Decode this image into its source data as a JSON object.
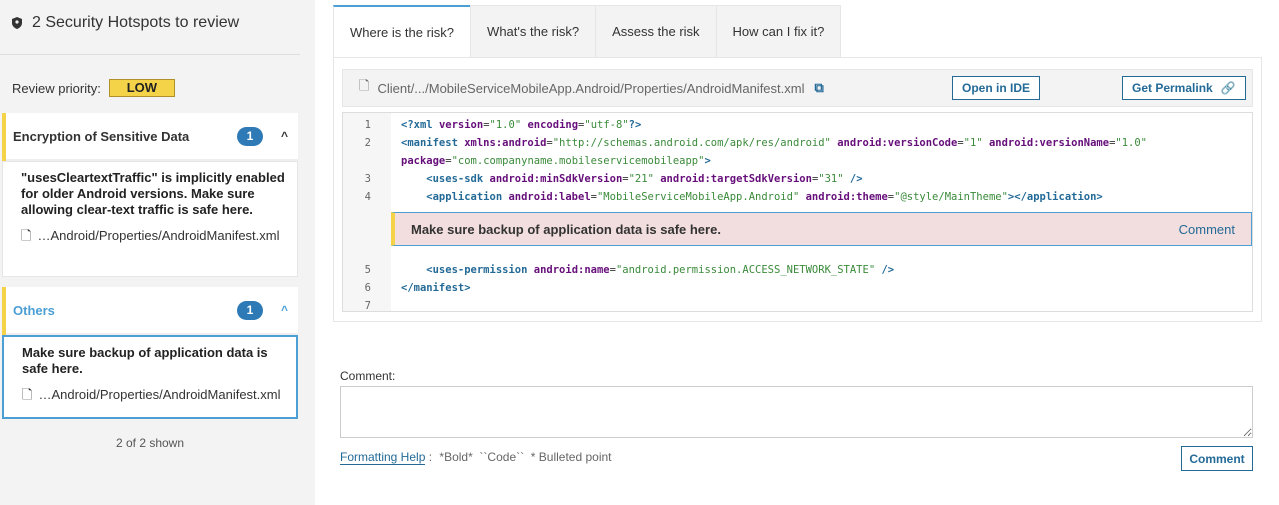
{
  "sidebar": {
    "title": "2 Security Hotspots to review",
    "review_priority_label": "Review priority:",
    "review_priority": "LOW",
    "categories": [
      {
        "name": "Encryption of Sensitive Data",
        "count": "1",
        "items": [
          {
            "message": "\"usesCleartextTraffic\" is implicitly enabled for older Android versions. Make sure allowing clear-text traffic is safe here.",
            "file": "…Android/Properties/AndroidManifest.xml"
          }
        ]
      },
      {
        "name": "Others",
        "count": "1",
        "items": [
          {
            "message": "Make sure backup of application data is safe here.",
            "file": "…Android/Properties/AndroidManifest.xml"
          }
        ]
      }
    ],
    "shown": "2 of 2 shown"
  },
  "tabs": [
    "Where is the risk?",
    "What's the risk?",
    "Assess the risk",
    "How can I fix it?"
  ],
  "code_viewer": {
    "path": "Client/.../MobileServiceMobileApp.Android/Properties/AndroidManifest.xml",
    "open_in_ide": "Open in IDE",
    "get_permalink": "Get Permalink",
    "lines": [
      {
        "n": "1",
        "tokens": [
          [
            "t",
            "<?xml "
          ],
          [
            "a",
            "version"
          ],
          [
            "p",
            "="
          ],
          [
            "v",
            "\"1.0\""
          ],
          [
            "a",
            " encoding"
          ],
          [
            "p",
            "="
          ],
          [
            "v",
            "\"utf-8\""
          ],
          [
            "t",
            "?>"
          ]
        ]
      },
      {
        "n": "2",
        "tokens": [
          [
            "t",
            "<manifest "
          ],
          [
            "a",
            "xmlns:android"
          ],
          [
            "p",
            "="
          ],
          [
            "v",
            "\"http://schemas.android.com/apk/res/android\""
          ],
          [
            "a",
            " android:versionCode"
          ],
          [
            "p",
            "="
          ],
          [
            "v",
            "\"1\""
          ],
          [
            "a",
            " android:versionName"
          ],
          [
            "p",
            "="
          ],
          [
            "v",
            "\"1.0\""
          ]
        ]
      },
      {
        "n": "",
        "tokens": [
          [
            "a",
            "package"
          ],
          [
            "p",
            "="
          ],
          [
            "v",
            "\"com.companyname.mobileservicemobileapp\""
          ],
          [
            "t",
            ">"
          ]
        ]
      },
      {
        "n": "3",
        "tokens": [
          [
            "t",
            "    <uses-sdk "
          ],
          [
            "a",
            "android:minSdkVersion"
          ],
          [
            "p",
            "="
          ],
          [
            "v",
            "\"21\""
          ],
          [
            "a",
            " android:targetSdkVersion"
          ],
          [
            "p",
            "="
          ],
          [
            "v",
            "\"31\""
          ],
          [
            "t",
            " />"
          ]
        ]
      },
      {
        "n": "4",
        "tokens": [
          [
            "t",
            "    <application "
          ],
          [
            "a",
            "android:label"
          ],
          [
            "p",
            "="
          ],
          [
            "v",
            "\"MobileServiceMobileApp.Android\""
          ],
          [
            "a",
            " android:theme"
          ],
          [
            "p",
            "="
          ],
          [
            "v",
            "\"@style/MainTheme\""
          ],
          [
            "t",
            "></application>"
          ]
        ]
      },
      {
        "n": "5",
        "tokens": [
          [
            "t",
            "    <uses-permission "
          ],
          [
            "a",
            "android:name"
          ],
          [
            "p",
            "="
          ],
          [
            "v",
            "\"android.permission.ACCESS_NETWORK_STATE\""
          ],
          [
            "t",
            " />"
          ]
        ]
      },
      {
        "n": "6",
        "tokens": [
          [
            "t",
            "</manifest>"
          ]
        ]
      },
      {
        "n": "7",
        "tokens": []
      }
    ],
    "hotspot": {
      "message": "Make sure backup of application data is safe here.",
      "comment": "Comment"
    }
  },
  "comment": {
    "label": "Comment:",
    "value": "",
    "formatting_help": "Formatting Help",
    "separator": ":",
    "hints": "*Bold*  ``Code``  * Bulleted point",
    "submit": "Comment"
  },
  "colors": {
    "accent": "#236a97",
    "priority_low": "#f4d348",
    "hotspot_bg": "#f2dede",
    "selected_border": "#4b9fd5"
  }
}
